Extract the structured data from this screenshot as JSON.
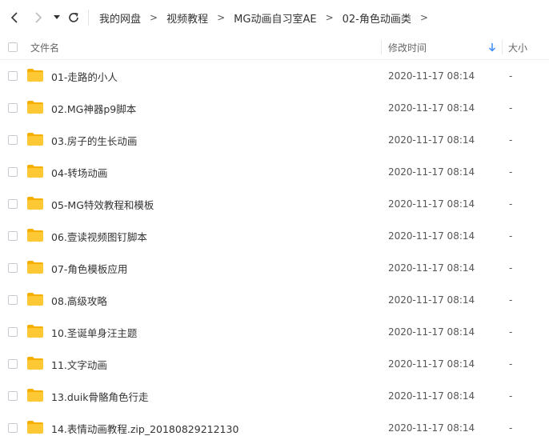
{
  "nav": {
    "breadcrumbs": [
      "我的网盘",
      "视频教程",
      "MG动画自习室AE",
      "02-角色动画类"
    ],
    "chevron": ">"
  },
  "header": {
    "name_label": "文件名",
    "time_label": "修改时间",
    "size_label": "大小",
    "sort_indicator": "arrow-down-icon"
  },
  "colors": {
    "folder": "#FFC935",
    "folder_dark": "#F6B100",
    "sort_arrow": "#3b8cff"
  },
  "files": [
    {
      "name": "01-走路的小人",
      "time": "2020-11-17 08:14",
      "size": "-"
    },
    {
      "name": "02.MG神器p9脚本",
      "time": "2020-11-17 08:14",
      "size": "-"
    },
    {
      "name": "03.房子的生长动画",
      "time": "2020-11-17 08:14",
      "size": "-"
    },
    {
      "name": "04-转场动画",
      "time": "2020-11-17 08:14",
      "size": "-"
    },
    {
      "name": "05-MG特效教程和模板",
      "time": "2020-11-17 08:14",
      "size": "-"
    },
    {
      "name": "06.壹读视频图钉脚本",
      "time": "2020-11-17 08:14",
      "size": "-"
    },
    {
      "name": "07-角色模板应用",
      "time": "2020-11-17 08:14",
      "size": "-"
    },
    {
      "name": "08.高级攻略",
      "time": "2020-11-17 08:14",
      "size": "-"
    },
    {
      "name": "10.圣诞单身汪主题",
      "time": "2020-11-17 08:14",
      "size": "-"
    },
    {
      "name": "11.文字动画",
      "time": "2020-11-17 08:14",
      "size": "-"
    },
    {
      "name": "13.duik骨骼角色行走",
      "time": "2020-11-17 08:14",
      "size": "-"
    },
    {
      "name": "14.表情动画教程.zip_20180829212130",
      "time": "2020-11-17 08:14",
      "size": "-"
    }
  ]
}
